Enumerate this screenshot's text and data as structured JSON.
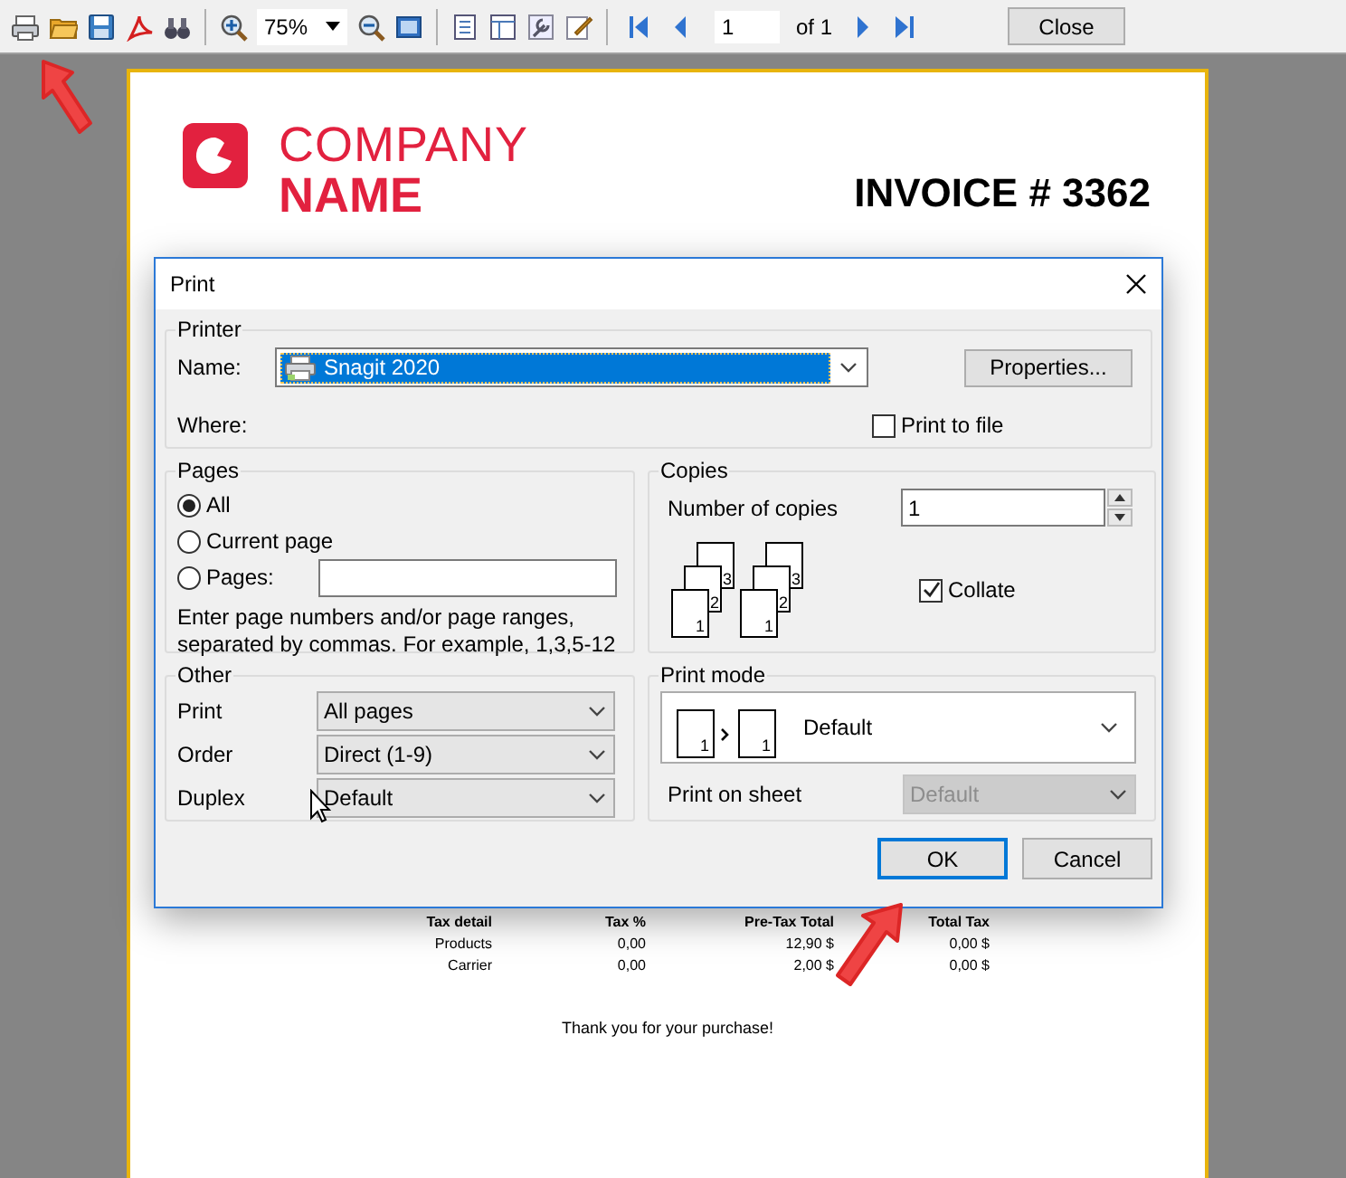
{
  "toolbar": {
    "zoom": "75%",
    "page": "1",
    "page_count": "of 1",
    "close": "Close"
  },
  "invoice": {
    "company_line1": "COMPANY",
    "company_line2": "NAME",
    "title": "INVOICE # 3362",
    "tax_table": {
      "columns": [
        "Tax detail",
        "Tax %",
        "Pre-Tax Total",
        "Total Tax"
      ],
      "rows": [
        [
          "Products",
          "0,00",
          "12,90 $",
          "0,00 $"
        ],
        [
          "Carrier",
          "0,00",
          "2,00 $",
          "0,00 $"
        ]
      ]
    },
    "thanks": "Thank you for your purchase!"
  },
  "dialog": {
    "title": "Print",
    "printer": {
      "group": "Printer",
      "name_label": "Name:",
      "name_value": "Snagit 2020",
      "properties": "Properties...",
      "where_label": "Where:",
      "print_to_file": {
        "label": "Print to file",
        "checked": false
      }
    },
    "pages": {
      "group": "Pages",
      "options": [
        {
          "label": "All",
          "selected": true,
          "kind": "radio"
        },
        {
          "label": "Current page",
          "selected": false,
          "kind": "radio"
        },
        {
          "label": "Pages:",
          "selected": false,
          "kind": "radio-field"
        }
      ],
      "hint": "Enter page numbers and/or page ranges, separated by commas. For example, 1,3,5-12"
    },
    "copies": {
      "group": "Copies",
      "label": "Number of copies",
      "value": "1",
      "page_labels": [
        [
          "3",
          "2",
          "1"
        ],
        [
          "3",
          "2",
          "1"
        ]
      ],
      "collate": {
        "label": "Collate",
        "checked": true
      }
    },
    "other": {
      "group": "Other",
      "rows": [
        {
          "label": "Print",
          "value": "All pages"
        },
        {
          "label": "Order",
          "value": "Direct (1-9)"
        },
        {
          "label": "Duplex",
          "value": "Default"
        }
      ]
    },
    "print_mode": {
      "group": "Print mode",
      "value": "Default",
      "page_labels": [
        "1",
        "1"
      ],
      "sheet_label": "Print on sheet",
      "sheet_value": "Default",
      "sheet_disabled": true
    },
    "buttons": [
      {
        "label": "OK",
        "default": true
      },
      {
        "label": "Cancel",
        "default": false
      }
    ]
  }
}
